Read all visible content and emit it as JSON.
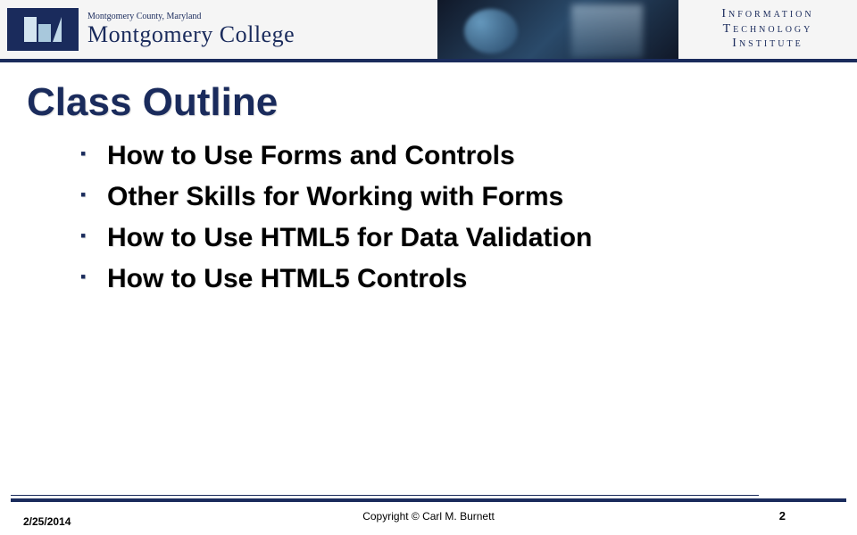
{
  "header": {
    "tagline": "Montgomery County, Maryland",
    "college_name": "Montgomery College",
    "institute": {
      "line1": "Information",
      "line2": "Technology",
      "line3": "Institute"
    }
  },
  "slide": {
    "title": "Class Outline",
    "bullets": [
      "How to Use Forms and Controls",
      "Other Skills for Working with Forms",
      "How to Use HTML5 for Data Validation",
      "How to Use HTML5 Controls"
    ]
  },
  "footer": {
    "date": "2/25/2014",
    "copyright": "Copyright © Carl M. Burnett",
    "page": "2"
  }
}
